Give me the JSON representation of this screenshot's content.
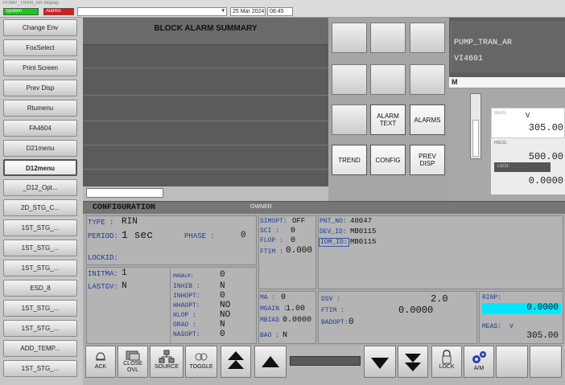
{
  "topbar": {
    "status_green": "System",
    "status_red": "Alarms",
    "path": "PUMP_TRAN_AR display",
    "dropdown": "",
    "date": "25 Mar 2024",
    "time": "08:45"
  },
  "sidebar": {
    "items": [
      {
        "label": "Change Env"
      },
      {
        "label": "FoxSelect"
      },
      {
        "label": "Print Screen"
      },
      {
        "label": "Prev Disp"
      },
      {
        "label": "Rtumenu"
      },
      {
        "label": "FA4604"
      },
      {
        "label": "D21menu"
      },
      {
        "label": "D12menu"
      },
      {
        "label": "_D12_Opt..."
      },
      {
        "label": "2D_STG_C..."
      },
      {
        "label": "1ST_STG_..."
      },
      {
        "label": "1ST_STG_..."
      },
      {
        "label": "1ST_STG_..."
      },
      {
        "label": "ESD_8"
      },
      {
        "label": "1ST_STG_..."
      },
      {
        "label": "1ST_STG_..."
      },
      {
        "label": "ADD_TEMP..."
      },
      {
        "label": "1ST_STG_..."
      }
    ]
  },
  "alarm_summary": {
    "title": "BLOCK ALARM SUMMARY"
  },
  "buttons": {
    "alarm_text": "ALARM TEXT",
    "alarms": "ALARMS",
    "trend": "TREND",
    "config": "CONFIG",
    "prev_disp": "PREV DISP"
  },
  "faceplate": {
    "compound": "PUMP_TRAN_AR",
    "block": "VI4601",
    "mode": "M",
    "meas_label": "MEAS:",
    "meas_unit": "V",
    "meas_value": "305.00",
    "hscl_label": "HSCI1:",
    "hscl_value": "500.00",
    "lscl_label": "LSCI1:",
    "lscl_value": "0.0000",
    "bar_level_percent": 61
  },
  "config": {
    "title": "CONFIGURATION",
    "owner_label": "OWNER",
    "type_label": "TYPE  :",
    "type_value": "RIN",
    "period_label": "PERIOD:",
    "period_value": "1 sec",
    "phase_label": "PHASE :",
    "phase_value": "0",
    "lockid_label": "LOCKID:",
    "simopt_label": "SIMOPT:",
    "simopt_value": "OFF",
    "sci_label": "SCI   :",
    "sci_value": "0",
    "flop_label": "FLOP  :",
    "flop_value": "0",
    "ftim_label": "FTIM  :",
    "ftim_value": "0.000",
    "pnt_no_label": "PNT_NO:",
    "pnt_no_value": "40047",
    "dev_id_label": "DEV_ID:",
    "dev_id_value": "MB0115",
    "iom_id_label": "IOM_ID:",
    "iom_id_value": "MB0115",
    "initma_label": "INITMA:",
    "initma_value": "1",
    "lastgv_label": "LASTGV:",
    "lastgv_value": "N",
    "manalm_label": "MANALM:",
    "manalm_value": "0",
    "inhib_label": "INHIB :",
    "inhib_value": "N",
    "inhopt_label": "INHOPT:",
    "inhopt_value": "0",
    "hhaopt_label": "HHAOPT:",
    "hhaopt_value": "NO",
    "hlop_label": "HLOP  :",
    "hlop_value": "NO",
    "orao_label": "ORAO  :",
    "orao_value": "N",
    "nasopt_label": "NASOPT:",
    "nasopt_value": "0",
    "ma_label": "MA    :",
    "ma_value": "0",
    "mgain_label": "MGAIN :",
    "mgain_value": "1.00",
    "mbias_label": "MBIAS :",
    "mbias_value": "0.0000",
    "bao_label": "BAO   :",
    "bao_value": "N",
    "dsv_label": "DSV   :",
    "dsv_value": "2.0",
    "ftim2_label": "FTIM  :",
    "ftim2_value": "0.0000",
    "badopt_label": "BADOPT:",
    "badopt_value": "0",
    "rinp_label": "RINP:",
    "rinp_value": "0.0000",
    "meas_label": "MEAS:",
    "meas_unit": "V",
    "meas_value": "305.00"
  },
  "bottombar": {
    "ack": "ACK",
    "close_ovl": "CLOSE OVL",
    "source": "SOURCE",
    "toggle": "TOGGLE",
    "lock": "LOCK",
    "am": "A/M"
  },
  "colors": {
    "status_green": "#18c818",
    "status_red": "#e01818",
    "cyan": "#00e8ff",
    "label_blue": "#1e3c96"
  }
}
